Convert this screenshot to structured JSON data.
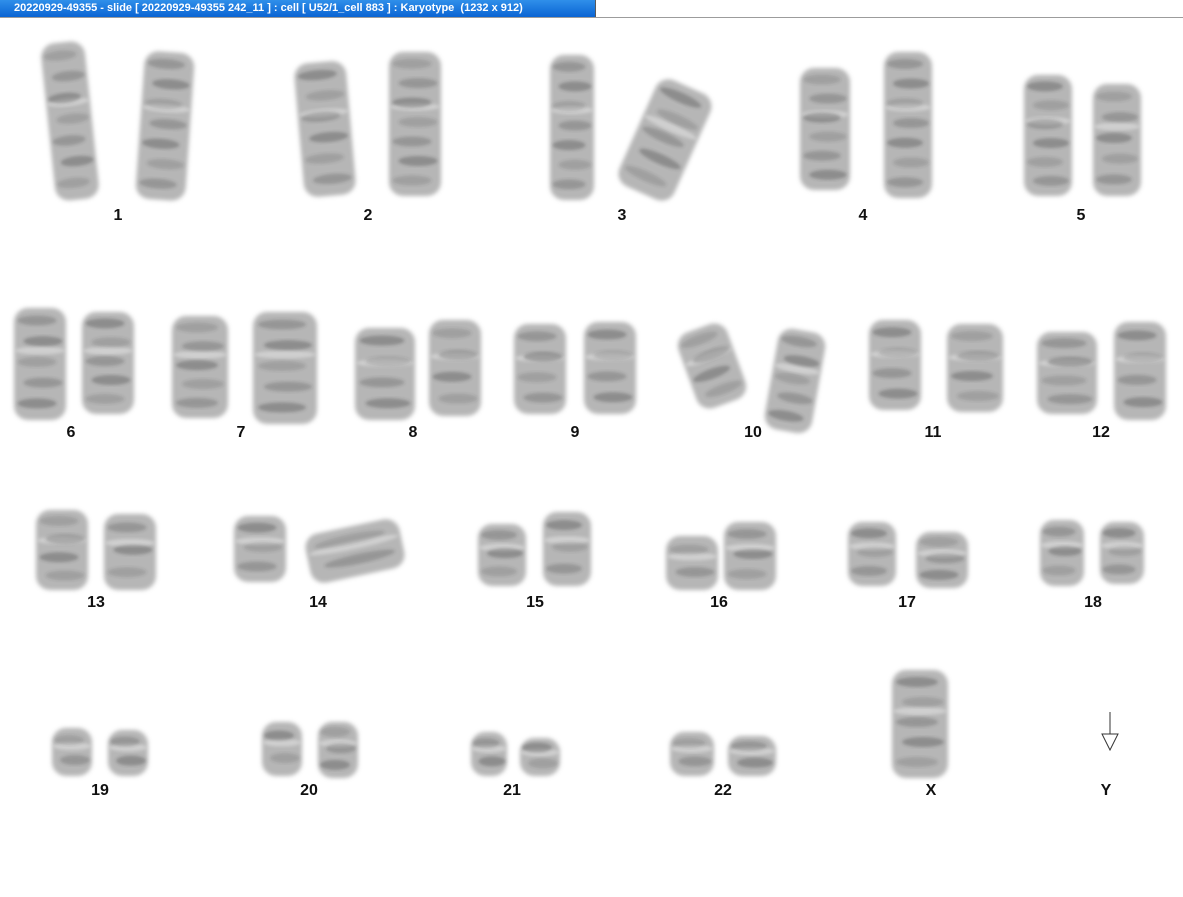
{
  "window": {
    "title": "20220929-49355 - slide [ 20220929-49355 242_11 ] : cell [ U52/1_cell 883 ] : Karyotype  (1232 x 912)"
  },
  "colors": {
    "title_bar": "#0a64d3",
    "title_text": "#ffffff",
    "background": "#ffffff",
    "chromosome_gray": "#7a7a7a",
    "label_text": "#111111"
  },
  "karyotype": {
    "labels": [
      "1",
      "2",
      "3",
      "4",
      "5",
      "6",
      "7",
      "8",
      "9",
      "10",
      "11",
      "12",
      "13",
      "14",
      "15",
      "16",
      "17",
      "18",
      "19",
      "20",
      "21",
      "22",
      "X",
      "Y"
    ],
    "y_marker_icon": "down-arrow-icon"
  }
}
